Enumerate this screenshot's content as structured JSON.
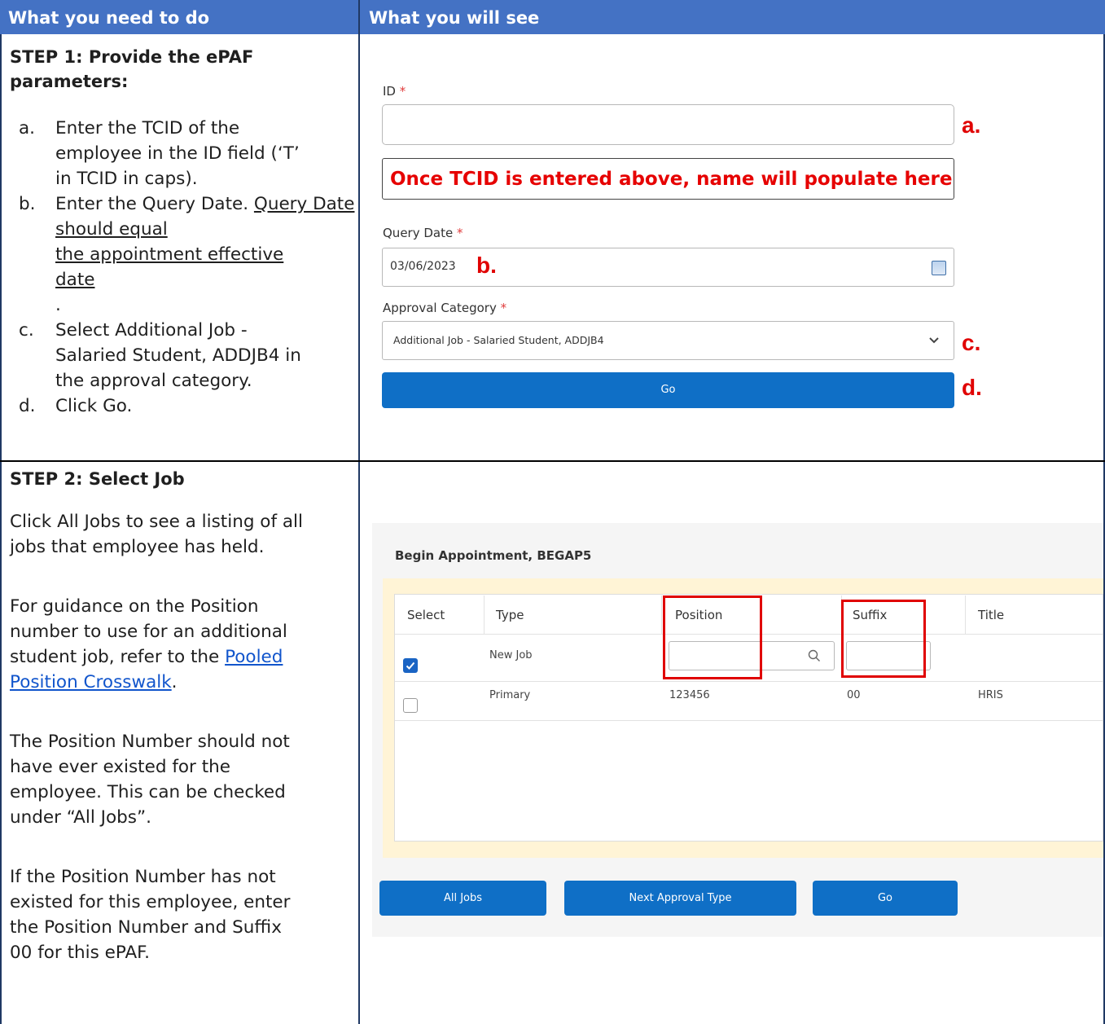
{
  "header": {
    "col1": "What you need to do",
    "col2": "What you will see"
  },
  "step1": {
    "title_line1": "STEP 1: Provide the ePAF",
    "title_line2": "parameters:",
    "items": [
      {
        "marker": "a.",
        "lines": [
          "Enter the TCID of the",
          "employee in the ID field (‘T’",
          "in TCID in caps)."
        ]
      },
      {
        "marker": "b.",
        "line1": "Enter the Query Date.",
        "underlined": [
          "Query Date should equal",
          "the appointment effective",
          "date"
        ],
        "tail": "."
      },
      {
        "marker": "c.",
        "lines": [
          "Select Additional Job -",
          "Salaried Student, ADDJB4 in",
          "the approval category."
        ]
      },
      {
        "marker": "d.",
        "lines": [
          "Click Go."
        ]
      }
    ],
    "form": {
      "id_label": "ID",
      "required_mark": "*",
      "id_value": "",
      "name_note": "Once TCID is entered above, name will populate here",
      "query_date_label": "Query Date",
      "query_date_value": "03/06/2023",
      "approval_label": "Approval Category",
      "approval_value": "Additional Job - Salaried Student, ADDJB4",
      "go_label": "Go",
      "callouts": {
        "a": "a.",
        "b": "b.",
        "c": "c.",
        "d": "d."
      }
    }
  },
  "step2": {
    "title": "STEP 2: Select Job",
    "p1": [
      "Click All Jobs to see a listing of all",
      "jobs that employee has held."
    ],
    "p2_lines": [
      "For guidance on the Position",
      "number to use for an additional"
    ],
    "p2_prefix": "student job, refer to the",
    "p2_link": [
      "Pooled",
      "Position Crosswalk"
    ],
    "p2_suffix": ".",
    "p3": [
      "The Position Number should not",
      "have ever existed for the",
      "employee. This can be checked",
      "under “All Jobs”."
    ],
    "p4": [
      "If the Position Number has not",
      "existed for this employee, enter",
      "the Position Number and Suffix",
      "00 for this ePAF."
    ],
    "panel": {
      "title": "Begin Appointment, BEGAP5",
      "columns": [
        "Select",
        "Type",
        "Position",
        "Suffix",
        "Title"
      ],
      "rows": [
        {
          "selected": true,
          "type": "New Job",
          "position": "",
          "suffix": "",
          "title": ""
        },
        {
          "selected": false,
          "type": "Primary",
          "position": "123456",
          "suffix": "00",
          "title": "HRIS"
        }
      ],
      "buttons": [
        "All Jobs",
        "Next Approval Type",
        "Go"
      ]
    }
  },
  "colors": {
    "header_blue": "#4472c4",
    "button_blue": "#0f6fc6",
    "annotation_red": "#e00000"
  }
}
